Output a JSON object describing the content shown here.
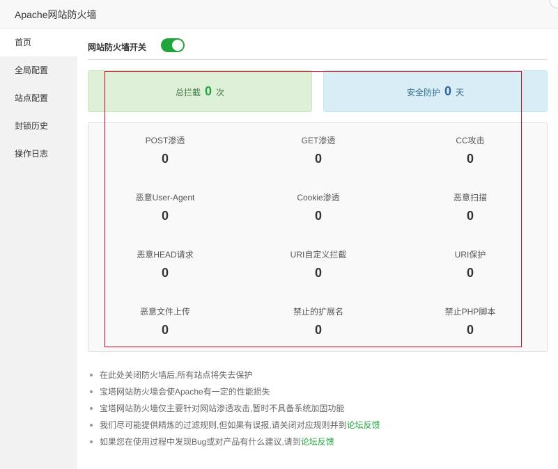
{
  "window": {
    "title": "Apache网站防火墙"
  },
  "sidebar": {
    "items": [
      {
        "label": "首页",
        "active": true
      },
      {
        "label": "全局配置"
      },
      {
        "label": "站点配置"
      },
      {
        "label": "封锁历史"
      },
      {
        "label": "操作日志"
      }
    ]
  },
  "main": {
    "switch_label": "网站防火墙开关",
    "switch_on": true,
    "stats": {
      "intercept_label": "总拦截",
      "intercept_count": "0",
      "intercept_unit": "次",
      "protect_label": "安全防护",
      "protect_count": "0",
      "protect_unit": "天"
    },
    "grid": [
      {
        "label": "POST渗透",
        "value": "0"
      },
      {
        "label": "GET渗透",
        "value": "0"
      },
      {
        "label": "CC攻击",
        "value": "0"
      },
      {
        "label": "恶意User-Agent",
        "value": "0"
      },
      {
        "label": "Cookie渗透",
        "value": "0"
      },
      {
        "label": "恶意扫描",
        "value": "0"
      },
      {
        "label": "恶意HEAD请求",
        "value": "0"
      },
      {
        "label": "URI自定义拦截",
        "value": "0"
      },
      {
        "label": "URI保护",
        "value": "0"
      },
      {
        "label": "恶意文件上传",
        "value": "0"
      },
      {
        "label": "禁止的扩展名",
        "value": "0"
      },
      {
        "label": "禁止PHP脚本",
        "value": "0"
      }
    ],
    "notes": [
      {
        "text": "在此处关闭防火墙后,所有站点将失去保护"
      },
      {
        "text": "宝塔网站防火墙会使Apache有一定的性能损失"
      },
      {
        "text": "宝塔网站防火墙仅主要针对网站渗透攻击,暂时不具备系统加固功能"
      },
      {
        "text": "我们尽可能提供精炼的过滤规则,但如果有误报,请关闭对应规则并到",
        "link": "论坛反馈"
      },
      {
        "text": "如果您在使用过程中发现Bug或对产品有什么建议,请到",
        "link": "论坛反馈"
      }
    ]
  },
  "colors": {
    "accent_green": "#20a53a",
    "highlight_frame": "#d9001b"
  }
}
